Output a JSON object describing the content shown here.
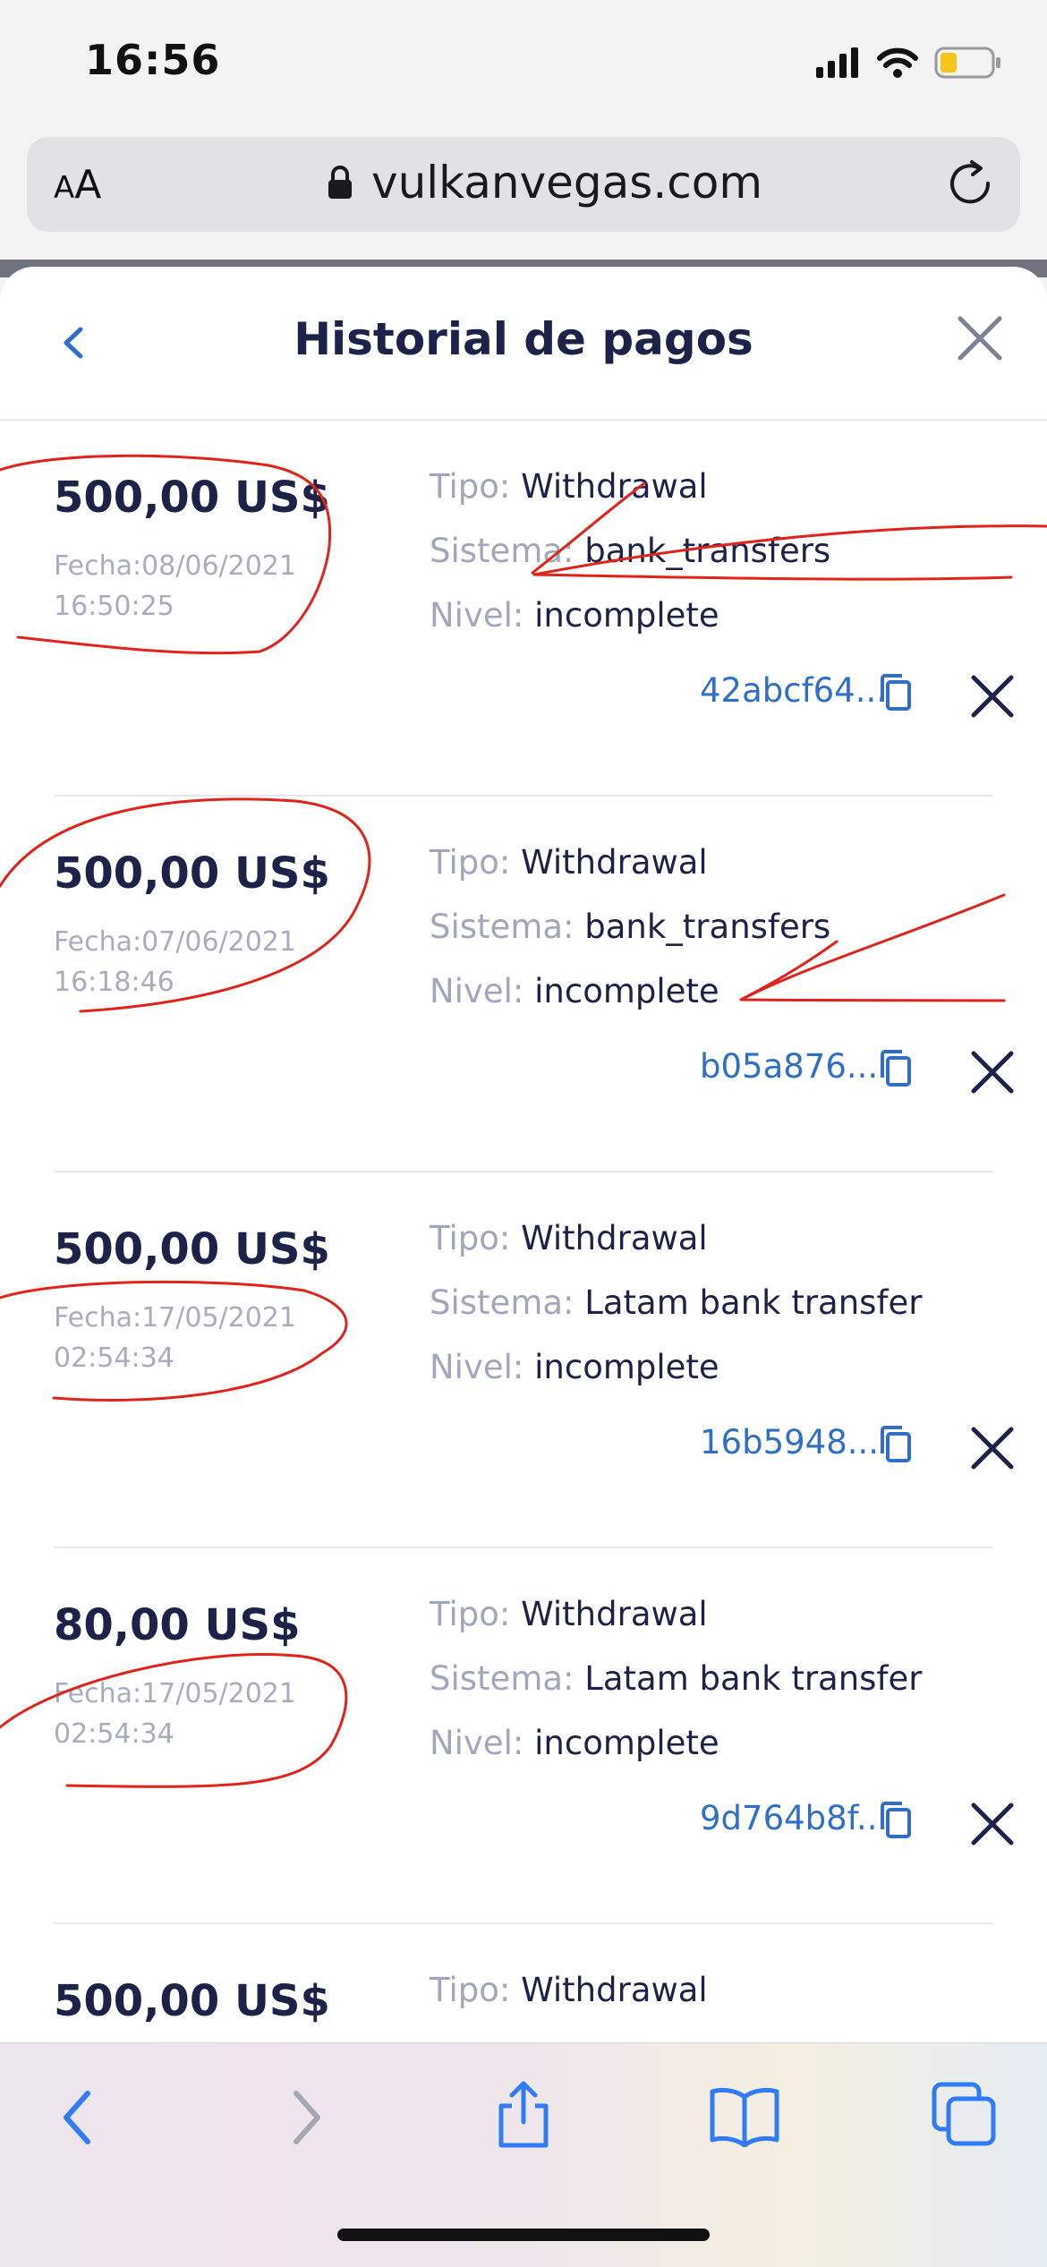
{
  "status_bar": {
    "time": "16:56"
  },
  "browser": {
    "text_size_label_small": "A",
    "text_size_label_large": "A",
    "url": "vulkanvegas.com"
  },
  "sheet": {
    "title": "Historial de pagos"
  },
  "labels": {
    "type": "Tipo:",
    "system": "Sistema:",
    "level": "Nivel:"
  },
  "payments": [
    {
      "amount": "500,00 US$",
      "date": "Fecha:08/06/2021",
      "time": "16:50:25",
      "type": "Withdrawal",
      "system": "bank_transfers",
      "level": "incomplete",
      "txid": "42abcf64..."
    },
    {
      "amount": "500,00 US$",
      "date": "Fecha:07/06/2021",
      "time": "16:18:46",
      "type": "Withdrawal",
      "system": "bank_transfers",
      "level": "incomplete",
      "txid": "b05a876..."
    },
    {
      "amount": "500,00 US$",
      "date": "Fecha:17/05/2021",
      "time": "02:54:34",
      "type": "Withdrawal",
      "system": "Latam bank transfer",
      "level": "incomplete",
      "txid": "16b5948..."
    },
    {
      "amount": "80,00 US$",
      "date": "Fecha:17/05/2021",
      "time": "02:54:34",
      "type": "Withdrawal",
      "system": "Latam bank transfer",
      "level": "incomplete",
      "txid": "9d764b8f..."
    },
    {
      "amount": "500,00 US$",
      "type": "Withdrawal"
    }
  ],
  "colors": {
    "primary_text": "#1c2248",
    "muted_text": "#a0a7bc",
    "link": "#2f6fc7",
    "annotation": "#e0231b",
    "safari_blue": "#2f7cf6"
  },
  "icons": {
    "signal": "signal-icon",
    "wifi": "wifi-icon",
    "battery": "battery-icon",
    "lock": "lock-icon",
    "reload": "reload-icon",
    "back": "chevron-left-icon",
    "close": "close-icon",
    "copy": "copy-icon",
    "cancel": "cancel-x-icon",
    "share": "share-icon",
    "bookmarks": "book-icon",
    "tabs": "tabs-icon"
  }
}
